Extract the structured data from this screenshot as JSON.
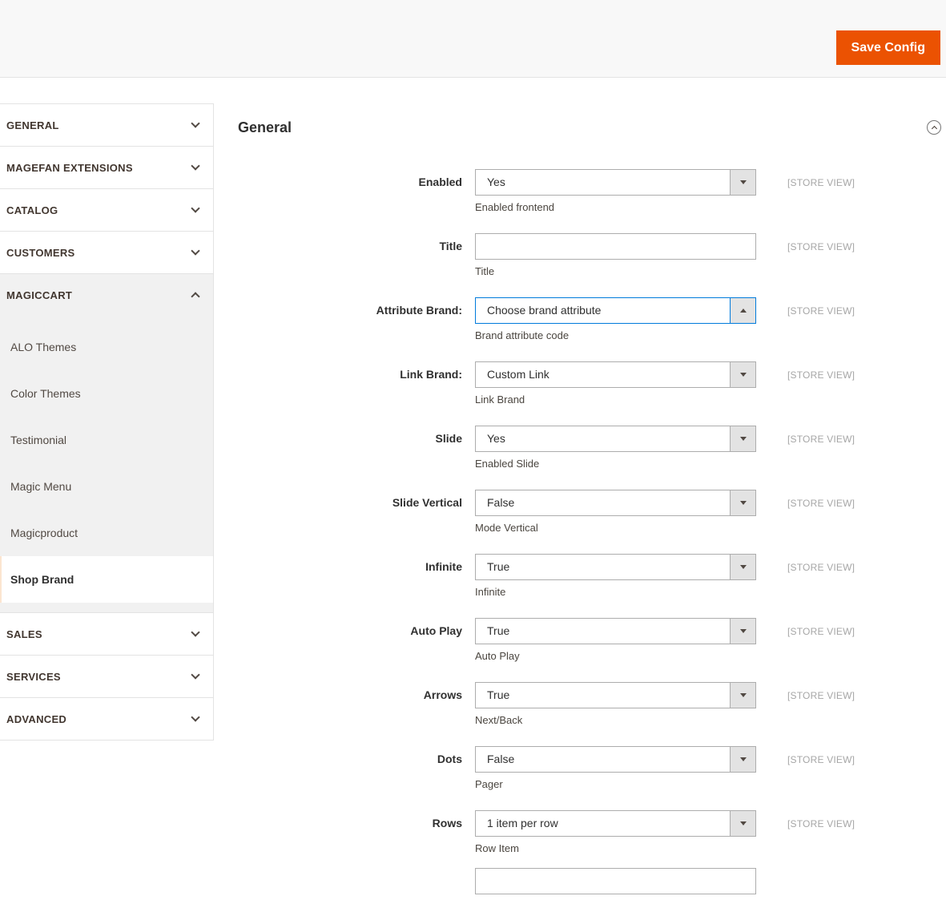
{
  "header": {
    "save_button_label": "Save Config"
  },
  "sidebar": {
    "sections": [
      {
        "label": "GENERAL",
        "state": "collapsed"
      },
      {
        "label": "MAGEFAN EXTENSIONS",
        "state": "collapsed"
      },
      {
        "label": "CATALOG",
        "state": "collapsed"
      },
      {
        "label": "CUSTOMERS",
        "state": "collapsed"
      },
      {
        "label": "MAGICCART",
        "state": "expanded",
        "items": [
          {
            "label": "ALO Themes",
            "active": false
          },
          {
            "label": "Color Themes",
            "active": false
          },
          {
            "label": "Testimonial",
            "active": false
          },
          {
            "label": "Magic Menu",
            "active": false
          },
          {
            "label": "Magicproduct",
            "active": false
          },
          {
            "label": "Shop Brand",
            "active": true
          }
        ]
      },
      {
        "label": "SALES",
        "state": "collapsed"
      },
      {
        "label": "SERVICES",
        "state": "collapsed"
      },
      {
        "label": "ADVANCED",
        "state": "collapsed"
      }
    ]
  },
  "main": {
    "section_title": "General",
    "fields": [
      {
        "label": "Enabled",
        "type": "select",
        "value": "Yes",
        "note": "Enabled frontend",
        "scope": "[STORE VIEW]"
      },
      {
        "label": "Title",
        "type": "text",
        "value": "",
        "note": "Title",
        "scope": "[STORE VIEW]"
      },
      {
        "label": "Attribute Brand:",
        "type": "select",
        "value": "Choose brand attribute",
        "note": "Brand attribute code",
        "scope": "[STORE VIEW]",
        "focused": true
      },
      {
        "label": "Link Brand:",
        "type": "select",
        "value": "Custom Link",
        "note": "Link Brand",
        "scope": "[STORE VIEW]"
      },
      {
        "label": "Slide",
        "type": "select",
        "value": "Yes",
        "note": "Enabled Slide",
        "scope": "[STORE VIEW]"
      },
      {
        "label": "Slide Vertical",
        "type": "select",
        "value": "False",
        "note": "Mode Vertical",
        "scope": "[STORE VIEW]"
      },
      {
        "label": "Infinite",
        "type": "select",
        "value": "True",
        "note": "Infinite",
        "scope": "[STORE VIEW]"
      },
      {
        "label": "Auto Play",
        "type": "select",
        "value": "True",
        "note": "Auto Play",
        "scope": "[STORE VIEW]"
      },
      {
        "label": "Arrows",
        "type": "select",
        "value": "True",
        "note": "Next/Back",
        "scope": "[STORE VIEW]"
      },
      {
        "label": "Dots",
        "type": "select",
        "value": "False",
        "note": "Pager",
        "scope": "[STORE VIEW]"
      },
      {
        "label": "Rows",
        "type": "select",
        "value": "1 item per row",
        "note": "Row Item",
        "scope": "[STORE VIEW]"
      },
      {
        "label": "",
        "type": "text",
        "value": "",
        "note": "",
        "scope": "",
        "partial": true
      }
    ]
  },
  "colors": {
    "accent_orange": "#eb5202",
    "focus_blue": "#007bdb",
    "scope_gray": "#a6a6a6"
  }
}
